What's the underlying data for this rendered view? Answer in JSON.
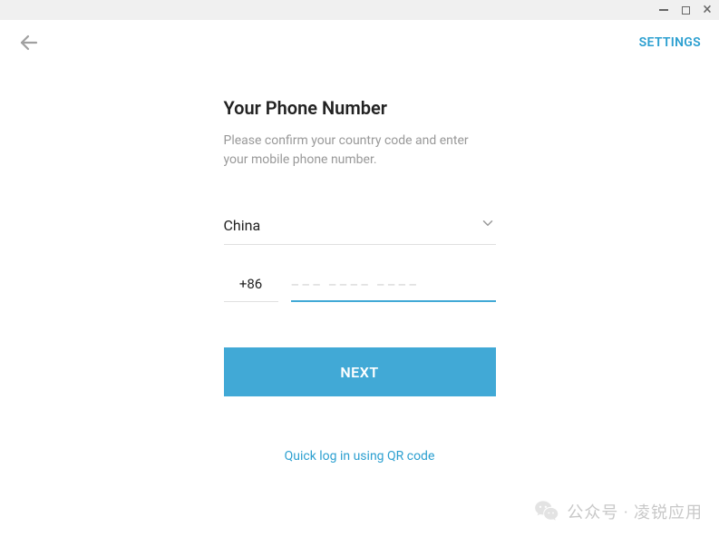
{
  "window": {
    "settings_label": "SETTINGS"
  },
  "form": {
    "title": "Your Phone Number",
    "subtitle": "Please confirm your country code and enter your mobile phone number.",
    "country": "China",
    "country_code": "+86",
    "phone_placeholder": "––– –––– ––––",
    "next_label": "NEXT",
    "qr_link": "Quick log in using QR code"
  },
  "watermark": {
    "text": "公众号 · 凌锐应用"
  }
}
